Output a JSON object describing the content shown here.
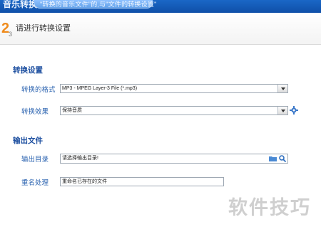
{
  "titlebar": {
    "app_title": "音乐转换",
    "breadcrumb": "\"转换的音乐文件\"的,与\"文件的转换设置\""
  },
  "step": {
    "number": "2",
    "subscript": "3",
    "title": "请进行转换设置"
  },
  "conversion_settings": {
    "heading": "转换设置",
    "format_label": "转换的格式",
    "format_value": "MP3 - MPEG Layer-3 File (*.mp3)",
    "effect_label": "转换效果",
    "effect_value": "保持音质"
  },
  "output_files": {
    "heading": "输出文件",
    "directory_label": "输出目录",
    "directory_value": "请选择输出目录!",
    "rename_label": "重名处理",
    "rename_value": "重命名已存在的文件"
  },
  "watermark": "软件技巧",
  "icons": {
    "gear": "gear-icon",
    "folder": "folder-icon",
    "search": "search-icon"
  },
  "colors": {
    "titlebar": "#1a67c6",
    "section_heading": "#1d4fa0",
    "label": "#2b63b0",
    "step_accent": "#ef8a1a"
  }
}
